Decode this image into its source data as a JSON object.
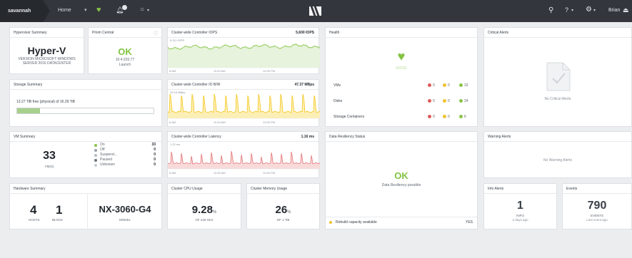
{
  "topbar": {
    "cluster_name": "savannah",
    "nav_home": "Home",
    "user_name": "Brian"
  },
  "hypervisor": {
    "title": "Hypervisor Summary",
    "name": "Hyper-V",
    "version_line1": "VERSION MICROSOFT WINDOWS",
    "version_line2": "SERVER 2016 DATACENTER"
  },
  "prism": {
    "title": "Prism Central",
    "status": "OK",
    "ip": "10.4.220.77",
    "launch": "Launch"
  },
  "iops": {
    "title": "Cluster-wide Controller IOPS",
    "max_value": "5,600 IOPS",
    "top_label": "5,111 IOPS",
    "t0": "8 AM",
    "t1": "11:00 AM",
    "t2": "12:00 PM"
  },
  "health": {
    "title": "Health",
    "status": "GOOD",
    "rows": [
      {
        "label": "VMs",
        "red": "0",
        "yellow": "0",
        "green": "33"
      },
      {
        "label": "Disks",
        "red": "0",
        "yellow": "0",
        "green": "24"
      },
      {
        "label": "Storage Containers",
        "red": "0",
        "yellow": "0",
        "green": "6"
      }
    ]
  },
  "critical": {
    "title": "Critical Alerts",
    "empty": "No Critical Alerts"
  },
  "storage": {
    "title": "Storage Summary",
    "free_strong": "13.27 TiB",
    "free_rest": "free (physical) of 16.29 TiB",
    "used_fraction": 0.17
  },
  "bw": {
    "title": "Cluster-wide Controller IO B/W",
    "max_value": "47.37 MBps",
    "top_label": "19.15 MBps",
    "t0": "8 AM",
    "t1": "11:00 AM",
    "t2": "12:00 PM"
  },
  "vm": {
    "title": "VM Summary",
    "count": "33",
    "count_label": "VM(S)",
    "items": [
      {
        "label": "On",
        "value": "33"
      },
      {
        "label": "Off",
        "value": "0"
      },
      {
        "label": "Suspend...",
        "value": "0"
      },
      {
        "label": "Paused",
        "value": "0"
      },
      {
        "label": "Unknown",
        "value": "0"
      }
    ]
  },
  "latency": {
    "title": "Cluster-wide Controller Latency",
    "max_value": "1.16 ms",
    "top_label": "1.22 ms",
    "t0": "8 AM",
    "t1": "11:00 AM",
    "t2": "12:00 PM"
  },
  "resiliency": {
    "title": "Data Resiliency Status",
    "status": "OK",
    "sub": "Data Resiliency possible",
    "footer_label": "Rebuild capacity available",
    "footer_value": "YES"
  },
  "warning": {
    "title": "Warning Alerts",
    "empty": "No Warning Alerts"
  },
  "hardware": {
    "title": "Hardware Summary",
    "hosts": "4",
    "hosts_label": "HOSTS",
    "blocks": "1",
    "blocks_label": "BLOCK",
    "model": "NX-3060-G4",
    "model_label": "MODEL"
  },
  "cpu": {
    "title": "Cluster CPU Usage",
    "value": "9.28",
    "unit": "%",
    "sub": "OF 240 GHz"
  },
  "memory": {
    "title": "Cluster Memory Usage",
    "value": "26",
    "unit": "%",
    "sub": "OF 1 TiB"
  },
  "info": {
    "title": "Info Alerts",
    "count": "1",
    "label": "INFO",
    "sub": "2 days ago"
  },
  "events": {
    "title": "Events",
    "count": "790",
    "label": "EVENTS",
    "sub": "Last event ago"
  },
  "colors": {
    "ok_green": "#82c341",
    "iops_line": "#82c341",
    "bw_line": "#f5c518",
    "latency_line": "#e57373",
    "dot_red": "#e05a5a",
    "dot_yellow": "#f2c233",
    "dot_green": "#8bc34a"
  }
}
